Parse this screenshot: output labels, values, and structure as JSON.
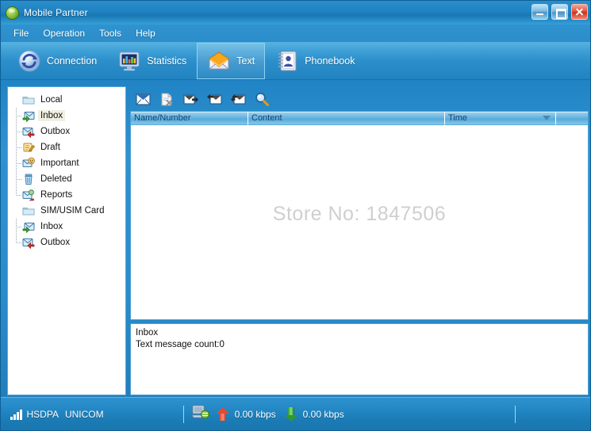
{
  "window": {
    "title": "Mobile Partner",
    "app_icon": "globe-green-icon",
    "buttons": {
      "minimize": "minimize-button",
      "maximize": "maximize-button",
      "close": "close-button"
    }
  },
  "menubar": {
    "items": [
      {
        "label": "File"
      },
      {
        "label": "Operation"
      },
      {
        "label": "Tools"
      },
      {
        "label": "Help"
      }
    ]
  },
  "navbar": {
    "tabs": [
      {
        "label": "Connection",
        "icon": "refresh-circle-icon",
        "selected": false
      },
      {
        "label": "Statistics",
        "icon": "bar-chart-monitor-icon",
        "selected": false
      },
      {
        "label": "Text",
        "icon": "open-envelope-icon",
        "selected": true
      },
      {
        "label": "Phonebook",
        "icon": "address-book-icon",
        "selected": false
      }
    ]
  },
  "sidebar": {
    "groups": [
      {
        "label": "Local",
        "icon": "folder-icon",
        "children": [
          {
            "label": "Inbox",
            "icon": "inbox-envelope-icon",
            "selected": true
          },
          {
            "label": "Outbox",
            "icon": "outbox-envelope-icon",
            "selected": false
          },
          {
            "label": "Draft",
            "icon": "draft-pencil-icon",
            "selected": false
          },
          {
            "label": "Important",
            "icon": "important-envelope-icon",
            "selected": false
          },
          {
            "label": "Deleted",
            "icon": "trash-bin-icon",
            "selected": false
          },
          {
            "label": "Reports",
            "icon": "report-envelope-icon",
            "selected": false
          }
        ]
      },
      {
        "label": "SIM/USIM Card",
        "icon": "folder-icon",
        "children": [
          {
            "label": "Inbox",
            "icon": "inbox-envelope-icon",
            "selected": false
          },
          {
            "label": "Outbox",
            "icon": "outbox-envelope-icon",
            "selected": false
          }
        ]
      }
    ]
  },
  "list_toolbar": {
    "buttons": [
      {
        "name": "new-message-button",
        "icon": "envelope-blue-icon"
      },
      {
        "name": "delete-message-button",
        "icon": "document-delete-icon"
      },
      {
        "name": "forward-message-button",
        "icon": "envelope-forward-icon"
      },
      {
        "name": "reply-message-button",
        "icon": "envelope-reply-icon"
      },
      {
        "name": "reply-all-button",
        "icon": "envelope-reply-all-icon"
      },
      {
        "name": "search-button",
        "icon": "magnifier-icon"
      }
    ]
  },
  "message_list": {
    "columns": [
      {
        "label": "Name/Number",
        "sorted": false
      },
      {
        "label": "Content",
        "sorted": false
      },
      {
        "label": "Time",
        "sorted": true
      },
      {
        "label": "",
        "sorted": false
      }
    ],
    "rows": [],
    "watermark": "Store No: 1847506"
  },
  "preview": {
    "folder": "Inbox",
    "count_text": "Text message count:0"
  },
  "statusbar": {
    "network_type": "HSDPA",
    "operator": "UNICOM",
    "signal_icon": "signal-bars-icon",
    "connection_icon": "network-connection-icon",
    "upload_icon": "arrow-up-red-icon",
    "upload_speed": "0.00 kbps",
    "download_icon": "arrow-down-green-icon",
    "download_speed": "0.00 kbps"
  },
  "colors": {
    "window_chrome": "#2188c6",
    "accent_border": "#5aa8d8",
    "panel_bg": "#ffffff",
    "selected_item_bg": "#f0efe2",
    "watermark": "#cfcfcf",
    "upload_arrow": "#e04b35",
    "download_arrow": "#2f9a2f",
    "close_button": "#c7331c"
  }
}
